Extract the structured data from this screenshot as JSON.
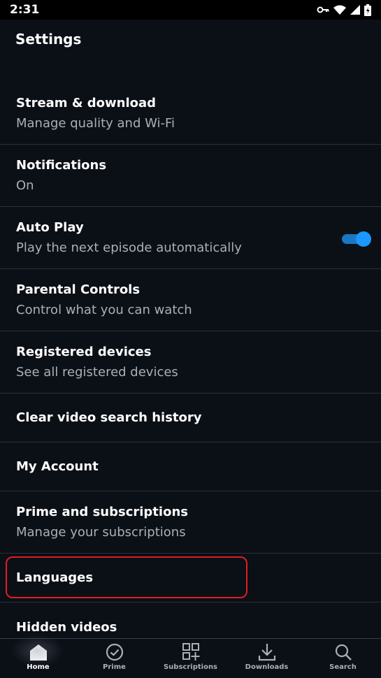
{
  "status_bar": {
    "time": "2:31"
  },
  "header": {
    "title": "Settings"
  },
  "settings": [
    {
      "title": "Stream & download",
      "subtitle": "Manage quality and Wi-Fi"
    },
    {
      "title": "Notifications",
      "subtitle": "On"
    },
    {
      "title": "Auto Play",
      "subtitle": "Play the next episode automatically",
      "toggle_on": true
    },
    {
      "title": "Parental Controls",
      "subtitle": "Control what you can watch"
    },
    {
      "title": "Registered devices",
      "subtitle": "See all registered devices"
    },
    {
      "title": "Clear video search history"
    },
    {
      "title": "My Account"
    },
    {
      "title": "Prime and subscriptions",
      "subtitle": "Manage your subscriptions"
    },
    {
      "title": "Languages"
    },
    {
      "title": "Hidden videos"
    }
  ],
  "bottom_nav": [
    {
      "label": "Home",
      "icon": "home-icon",
      "active": true
    },
    {
      "label": "Prime",
      "icon": "check-circle-icon"
    },
    {
      "label": "Subscriptions",
      "icon": "grid-plus-icon"
    },
    {
      "label": "Downloads",
      "icon": "download-icon"
    },
    {
      "label": "Search",
      "icon": "search-icon"
    }
  ],
  "colors": {
    "background": "#0b0f16",
    "accent": "#1a98ff",
    "highlight": "#e31b23"
  }
}
